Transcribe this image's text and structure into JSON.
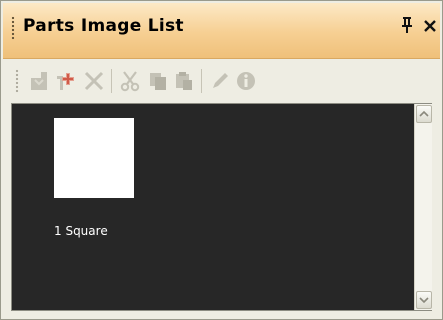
{
  "window": {
    "title": "Parts Image List"
  },
  "titlebar_buttons": {
    "pin_glyph": "ᵽ",
    "close_glyph": "×"
  },
  "toolbar": {
    "buttons": [
      {
        "icon": "import-image-icon"
      },
      {
        "icon": "add-part-icon"
      },
      {
        "icon": "delete-icon"
      },
      {
        "icon": "cut-icon"
      },
      {
        "icon": "copy-icon"
      },
      {
        "icon": "paste-icon"
      },
      {
        "icon": "edit-icon"
      },
      {
        "icon": "info-icon"
      }
    ]
  },
  "parts": [
    {
      "label": "1 Square",
      "color": "#ffffff"
    }
  ],
  "colors": {
    "title_bar": "#f6cf92",
    "content_background": "#272727",
    "panel_background": "#eeede3"
  }
}
